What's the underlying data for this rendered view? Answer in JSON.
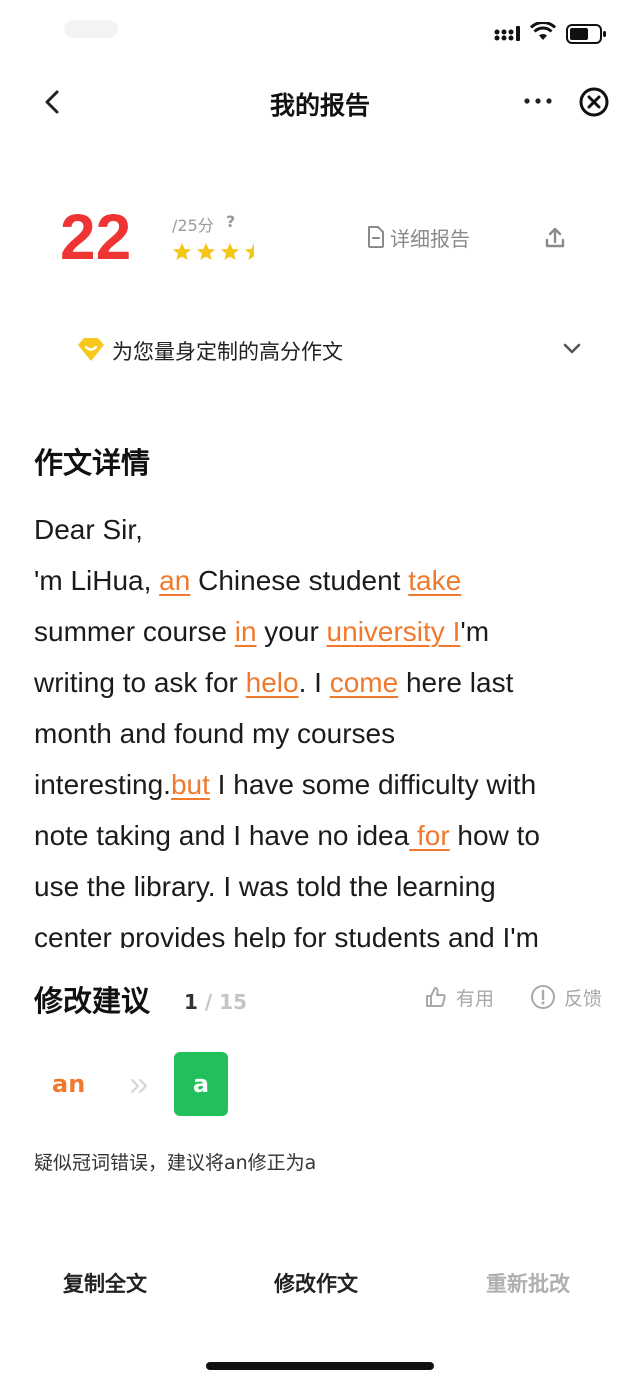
{
  "nav": {
    "title": "我的报告"
  },
  "score": {
    "value": "22",
    "total": "/25分",
    "help": "?",
    "stars_rating": 3.5,
    "stars_max": 4
  },
  "detail_report": {
    "label": "详细报告"
  },
  "custom_essay": {
    "label": "为您量身定制的高分作文"
  },
  "essay": {
    "title": "作文详情",
    "lines": [
      [
        {
          "t": "Dear Sir,"
        }
      ],
      [
        {
          "t": "'m LiHua, "
        },
        {
          "t": "an",
          "err": true
        },
        {
          "t": " Chinese student "
        },
        {
          "t": "take",
          "err": true
        }
      ],
      [
        {
          "t": "summer course "
        },
        {
          "t": "in",
          "err": true
        },
        {
          "t": " your "
        },
        {
          "t": "university I",
          "err": true
        },
        {
          "t": "'m"
        }
      ],
      [
        {
          "t": "writing to ask for "
        },
        {
          "t": "helo",
          "err": true
        },
        {
          "t": ". I "
        },
        {
          "t": "come",
          "err": true
        },
        {
          "t": " here last"
        }
      ],
      [
        {
          "t": "month and found my courses"
        }
      ],
      [
        {
          "t": "interesting."
        },
        {
          "t": "but",
          "err": true
        },
        {
          "t": " I have some difficulty with"
        }
      ],
      [
        {
          "t": "note taking and I have no idea"
        },
        {
          "t": " for",
          "err": true
        },
        {
          "t": " how to"
        }
      ],
      [
        {
          "t": "use the library. I was told the learning"
        }
      ],
      [
        {
          "t": "center provides help for students and I'm"
        }
      ]
    ]
  },
  "suggestions": {
    "title": "修改建议",
    "current": "1",
    "separator": "/",
    "total": "15",
    "useful_label": "有用",
    "feedback_label": "反馈",
    "wrong": "an",
    "right": "a",
    "description": "疑似冠词错误，建议将an修正为a"
  },
  "actions": {
    "copy": "复制全文",
    "edit": "修改作文",
    "regrade": "重新批改"
  },
  "colors": {
    "score": "#ef3434",
    "error": "#ef7a2e",
    "correct": "#22c05a",
    "star": "#f5c518"
  }
}
